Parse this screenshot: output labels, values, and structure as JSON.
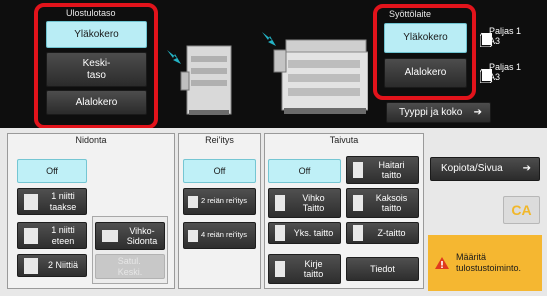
{
  "output_tray": {
    "title": "Ulostulotaso",
    "options": [
      "Yläkokero",
      "Keski-\ntaso",
      "Alalokero"
    ],
    "selected": "Yläkokero"
  },
  "input_tray": {
    "title": "Syöttölaite",
    "options": [
      "Yläkokero",
      "Alalokero"
    ],
    "selected": "Yläkokero",
    "paper_upper": {
      "type": "Paljas 1",
      "size": "A3"
    },
    "paper_lower": {
      "type": "Paljas 1",
      "size": "A3"
    },
    "type_size_button": "Tyyppi ja koko"
  },
  "stapling": {
    "title": "Nidonta",
    "off": "Off",
    "options": [
      "1 niitti\ntaakse",
      "1 niitti\neteen",
      "2 Niittiä"
    ],
    "saddle": "Vihko-\nSidonta",
    "disabled_option": "Satul.\nKeski."
  },
  "punch": {
    "title": "Rei'itys",
    "off": "Off",
    "options": [
      "2 reiän rei'itys",
      "4 reiän rei'itys"
    ]
  },
  "fold": {
    "title": "Taivuta",
    "off": "Off",
    "options": [
      "Vihko\nTaitto",
      "Yks. taitto",
      "Kirje\ntaitto",
      "Haitari\ntaitto",
      "Kaksois\ntaitto",
      "Z-taitto"
    ],
    "info": "Tiedot"
  },
  "copies_button": "Kopiota/Sivua",
  "ca_button": "CA",
  "warning": "Määritä\ntulostustoiminto.",
  "colors": {
    "accent_red": "#e2131b",
    "selected_cyan": "#b9edf5",
    "warning_bg": "#f5b731"
  }
}
